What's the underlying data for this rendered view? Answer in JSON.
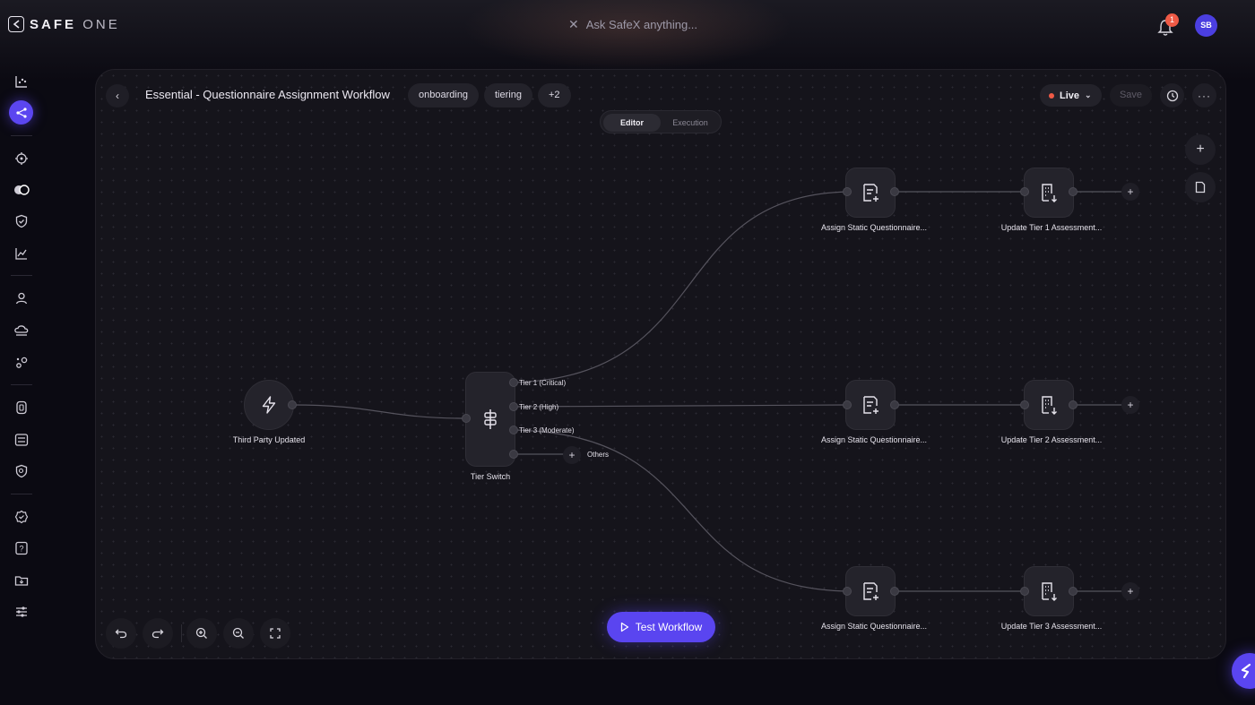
{
  "app": {
    "name_bold": "SAFE",
    "name_light": "ONE"
  },
  "search": {
    "placeholder": "Ask SafeX anything..."
  },
  "header": {
    "notification_count": "1",
    "avatar_initials": "SB"
  },
  "workflow": {
    "title": "Essential - Questionnaire Assignment Workflow",
    "tags": [
      "onboarding",
      "tiering",
      "+2"
    ],
    "status": "Live",
    "save_label": "Save",
    "tabs": {
      "editor": "Editor",
      "execution": "Execution"
    },
    "test_label": "Test Workflow"
  },
  "nodes": {
    "trigger": {
      "label": "Third Party Updated"
    },
    "switch": {
      "label": "Tier Switch",
      "branches": [
        "Tier 1 (Critical)",
        "Tier 2 (High)",
        "Tier 3 (Moderate)",
        "Others"
      ]
    },
    "assign": [
      {
        "label": "Assign Static Questionnaire..."
      },
      {
        "label": "Assign Static Questionnaire..."
      },
      {
        "label": "Assign Static Questionnaire..."
      }
    ],
    "update": [
      {
        "label": "Update Tier 1 Assessment..."
      },
      {
        "label": "Update Tier 2 Assessment..."
      },
      {
        "label": "Update Tier 3 Assessment..."
      }
    ]
  },
  "sidebar": {
    "icons": [
      "dashboard-icon",
      "workflow-icon",
      "target-icon",
      "toggle-icon",
      "shield-icon",
      "chart-icon",
      "user-icon",
      "cloud-icon",
      "integrations-icon",
      "database-icon",
      "list-icon",
      "search-shield-icon",
      "settings-icon",
      "help-icon",
      "folder-icon",
      "sliders-icon"
    ],
    "active": "workflow-icon"
  },
  "colors": {
    "accent": "#5a45f0",
    "live": "#ef5a46",
    "panel": "#15141b"
  }
}
